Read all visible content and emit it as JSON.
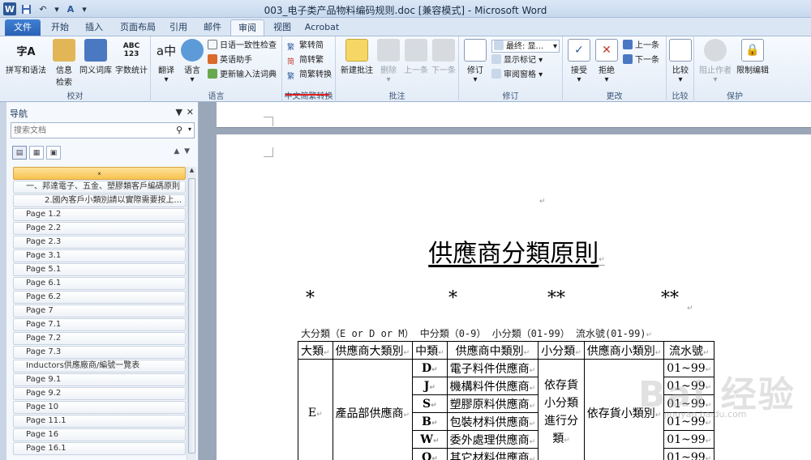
{
  "window": {
    "title": "003_电子类产品物料编码规则.doc [兼容模式] - Microsoft Word",
    "app_icon": "W"
  },
  "tabs": [
    "文件",
    "开始",
    "插入",
    "页面布局",
    "引用",
    "邮件",
    "审阅",
    "视图",
    "Acrobat"
  ],
  "active_tab": "审阅",
  "ribbon": {
    "proofing": {
      "label": "校对",
      "spell": "拼写和语法",
      "info_1": "信息",
      "info_2": "检索",
      "thesaurus": "同义词库",
      "wordcount": "字数统计"
    },
    "language": {
      "label": "语言",
      "translate": "翻译",
      "language": "语言",
      "consistency": "日语一致性检查",
      "english_assist": "英语助手",
      "ime_dict": "更新输入法词典"
    },
    "chinese_conv": {
      "label": "中文简繁转换",
      "trad_to_simp": "繁转简",
      "simp_to_trad": "简转繁",
      "conversion": "简繁转换"
    },
    "comments": {
      "label": "批注",
      "new": "新建批注",
      "delete": "删除",
      "prev": "上一条",
      "next": "下一条"
    },
    "tracking": {
      "label": "修订",
      "track": "修订",
      "final": "最终: 显...",
      "show_markup": "显示标记",
      "review_pane": "审阅窗格"
    },
    "changes": {
      "label": "更改",
      "accept": "接受",
      "reject": "拒绝",
      "prev": "上一条",
      "next": "下一条"
    },
    "compare": {
      "label": "比较",
      "compare": "比较"
    },
    "protect": {
      "label": "保护",
      "block_authors": "阻止作者",
      "restrict": "限制编辑"
    }
  },
  "nav": {
    "title": "导航",
    "search_placeholder": "搜索文档",
    "items": [
      {
        "text": "⌅",
        "level": 0,
        "selected": true
      },
      {
        "text": "一、邦達電子、五金、塑膠類客戶編碼原則",
        "level": 1
      },
      {
        "text": "2.國內客戶小類別請以實際需要按上...",
        "level": 2
      },
      {
        "text": "Page 1.2",
        "level": 1
      },
      {
        "text": "Page 2.2",
        "level": 1
      },
      {
        "text": "Page 2.3",
        "level": 1
      },
      {
        "text": "Page 3.1",
        "level": 1
      },
      {
        "text": "Page 5.1",
        "level": 1
      },
      {
        "text": "Page 6.1",
        "level": 1
      },
      {
        "text": "Page 6.2",
        "level": 1
      },
      {
        "text": "Page 7",
        "level": 1
      },
      {
        "text": "Page 7.1",
        "level": 1
      },
      {
        "text": "Page 7.2",
        "level": 1
      },
      {
        "text": "Page 7.3",
        "level": 1
      },
      {
        "text": "Inductors供應廠商/編號一覽表",
        "level": 1
      },
      {
        "text": "Page 9.1",
        "level": 1
      },
      {
        "text": "Page 9.2",
        "level": 1
      },
      {
        "text": "Page 10",
        "level": 1
      },
      {
        "text": "Page 11.1",
        "level": 1
      },
      {
        "text": "Page 16",
        "level": 1
      },
      {
        "text": "Page 16.1",
        "level": 1
      }
    ]
  },
  "document": {
    "title": "供應商分類原則",
    "stars": [
      "*",
      "*",
      "**",
      "**"
    ],
    "code_line": "大分類（E or D or M）    中分類（0-9）   小分類（01-99）    流水號(01-99)",
    "table": {
      "headers": [
        "大類",
        "供應商大類別",
        "中類",
        "供應商中類別",
        "小分類",
        "供應商小類別",
        "流水號"
      ],
      "major_code": "E",
      "major_name": "產品部供應商",
      "mid_rows": [
        {
          "code": "D",
          "name": "電子料件供應商",
          "serial": "01~99"
        },
        {
          "code": "J",
          "name": "機構料件供應商",
          "serial": "01~99"
        },
        {
          "code": "S",
          "name": "塑膠原料供應商",
          "serial": "01~99"
        },
        {
          "code": "B",
          "name": "包裝材料供應商",
          "serial": "01~99"
        },
        {
          "code": "W",
          "name": "委外處理供應商",
          "serial": "01~99"
        },
        {
          "code": "O",
          "name": "其它材料供應商",
          "serial": "01~99"
        }
      ],
      "sub_class": "依存貨小分類進行分類",
      "sub_name": "依存貨小類別"
    },
    "watermark": "Bai 经验",
    "watermark_url": "jingyan.baidu.com"
  }
}
